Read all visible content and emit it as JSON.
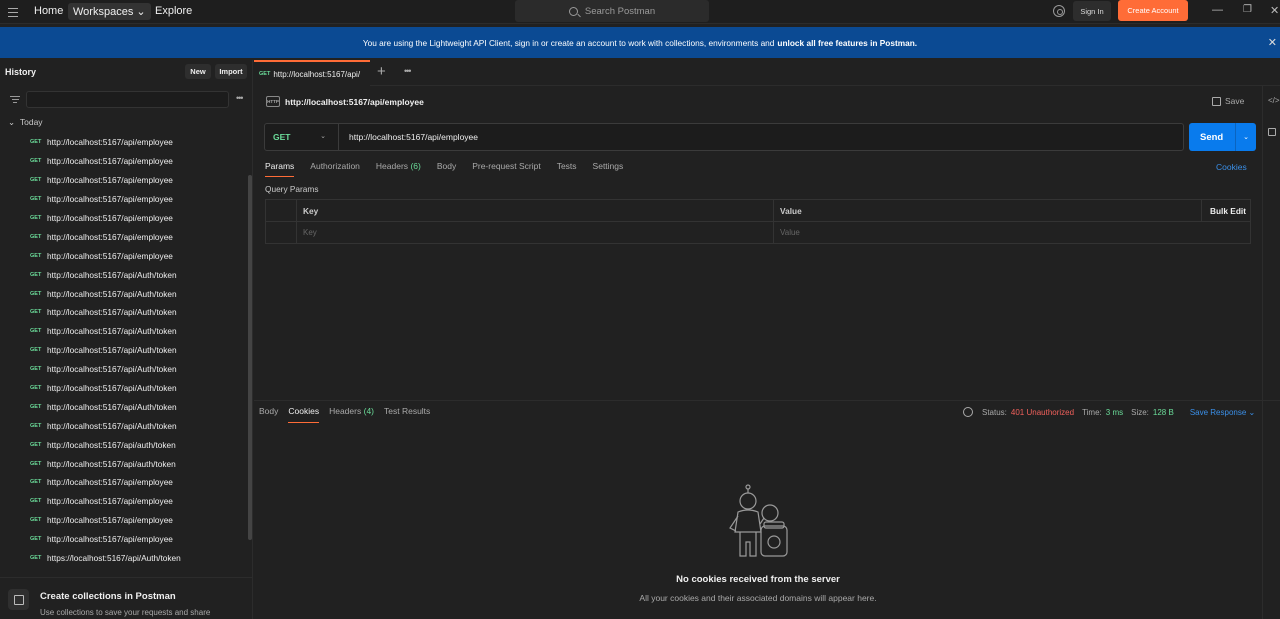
{
  "topbar": {
    "home": "Home",
    "workspaces": "Workspaces",
    "explore": "Explore",
    "search_placeholder": "Search Postman",
    "sign_in": "Sign In",
    "create_account": "Create Account"
  },
  "banner": {
    "text": "You are using the Lightweight API Client, sign in or create an account to work with collections, environments and",
    "bold": "unlock all free features in Postman."
  },
  "sidebar": {
    "title": "History",
    "new_label": "New",
    "import_label": "Import",
    "group": "Today",
    "items": [
      {
        "method": "GET",
        "url": "http://localhost:5167/api/employee"
      },
      {
        "method": "GET",
        "url": "http://localhost:5167/api/employee"
      },
      {
        "method": "GET",
        "url": "http://localhost:5167/api/employee"
      },
      {
        "method": "GET",
        "url": "http://localhost:5167/api/employee"
      },
      {
        "method": "GET",
        "url": "http://localhost:5167/api/employee"
      },
      {
        "method": "GET",
        "url": "http://localhost:5167/api/employee"
      },
      {
        "method": "GET",
        "url": "http://localhost:5167/api/employee"
      },
      {
        "method": "GET",
        "url": "http://localhost:5167/api/Auth/token"
      },
      {
        "method": "GET",
        "url": "http://localhost:5167/api/Auth/token"
      },
      {
        "method": "GET",
        "url": "http://localhost:5167/api/Auth/token"
      },
      {
        "method": "GET",
        "url": "http://localhost:5167/api/Auth/token"
      },
      {
        "method": "GET",
        "url": "http://localhost:5167/api/Auth/token"
      },
      {
        "method": "GET",
        "url": "http://localhost:5167/api/Auth/token"
      },
      {
        "method": "GET",
        "url": "http://localhost:5167/api/Auth/token"
      },
      {
        "method": "GET",
        "url": "http://localhost:5167/api/Auth/token"
      },
      {
        "method": "GET",
        "url": "http://localhost:5167/api/Auth/token"
      },
      {
        "method": "GET",
        "url": "http://localhost:5167/api/auth/token"
      },
      {
        "method": "GET",
        "url": "http://localhost:5167/api/auth/token"
      },
      {
        "method": "GET",
        "url": "http://localhost:5167/api/employee"
      },
      {
        "method": "GET",
        "url": "http://localhost:5167/api/employee"
      },
      {
        "method": "GET",
        "url": "http://localhost:5167/api/employee"
      },
      {
        "method": "GET",
        "url": "http://localhost:5167/api/employee"
      },
      {
        "method": "GET",
        "url": "https://localhost:5167/api/Auth/token"
      }
    ],
    "promo_title": "Create collections in Postman",
    "promo_sub": "Use collections to save your requests and share"
  },
  "tab": {
    "method": "GET",
    "label": "http://localhost:5167/api/"
  },
  "request": {
    "title": "http://localhost:5167/api/employee",
    "http_badge": "HTTP",
    "save": "Save",
    "method": "GET",
    "url": "http://localhost:5167/api/employee",
    "send": "Send",
    "tabs": {
      "params": "Params",
      "authorization": "Authorization",
      "headers": "Headers",
      "headers_count": "(6)",
      "body": "Body",
      "prerequest": "Pre-request Script",
      "tests": "Tests",
      "settings": "Settings"
    },
    "cookies": "Cookies",
    "query_params": "Query Params",
    "table": {
      "key_header": "Key",
      "value_header": "Value",
      "bulk_edit": "Bulk Edit",
      "key_placeholder": "Key",
      "value_placeholder": "Value"
    }
  },
  "response": {
    "tabs": {
      "body": "Body",
      "cookies": "Cookies",
      "headers": "Headers",
      "headers_count": "(4)",
      "test_results": "Test Results"
    },
    "status_label": "Status:",
    "status_value": "401 Unauthorized",
    "time_label": "Time:",
    "time_value": "3 ms",
    "size_label": "Size:",
    "size_value": "128 B",
    "save_response": "Save Response",
    "empty_title": "No cookies received from the server",
    "empty_sub": "All your cookies and their associated domains will appear here."
  },
  "colors": {
    "accent": "#ff6c37",
    "send": "#097bed",
    "banner": "#0b4a93",
    "get_method": "#6bdd9a",
    "error": "#f0605b"
  }
}
